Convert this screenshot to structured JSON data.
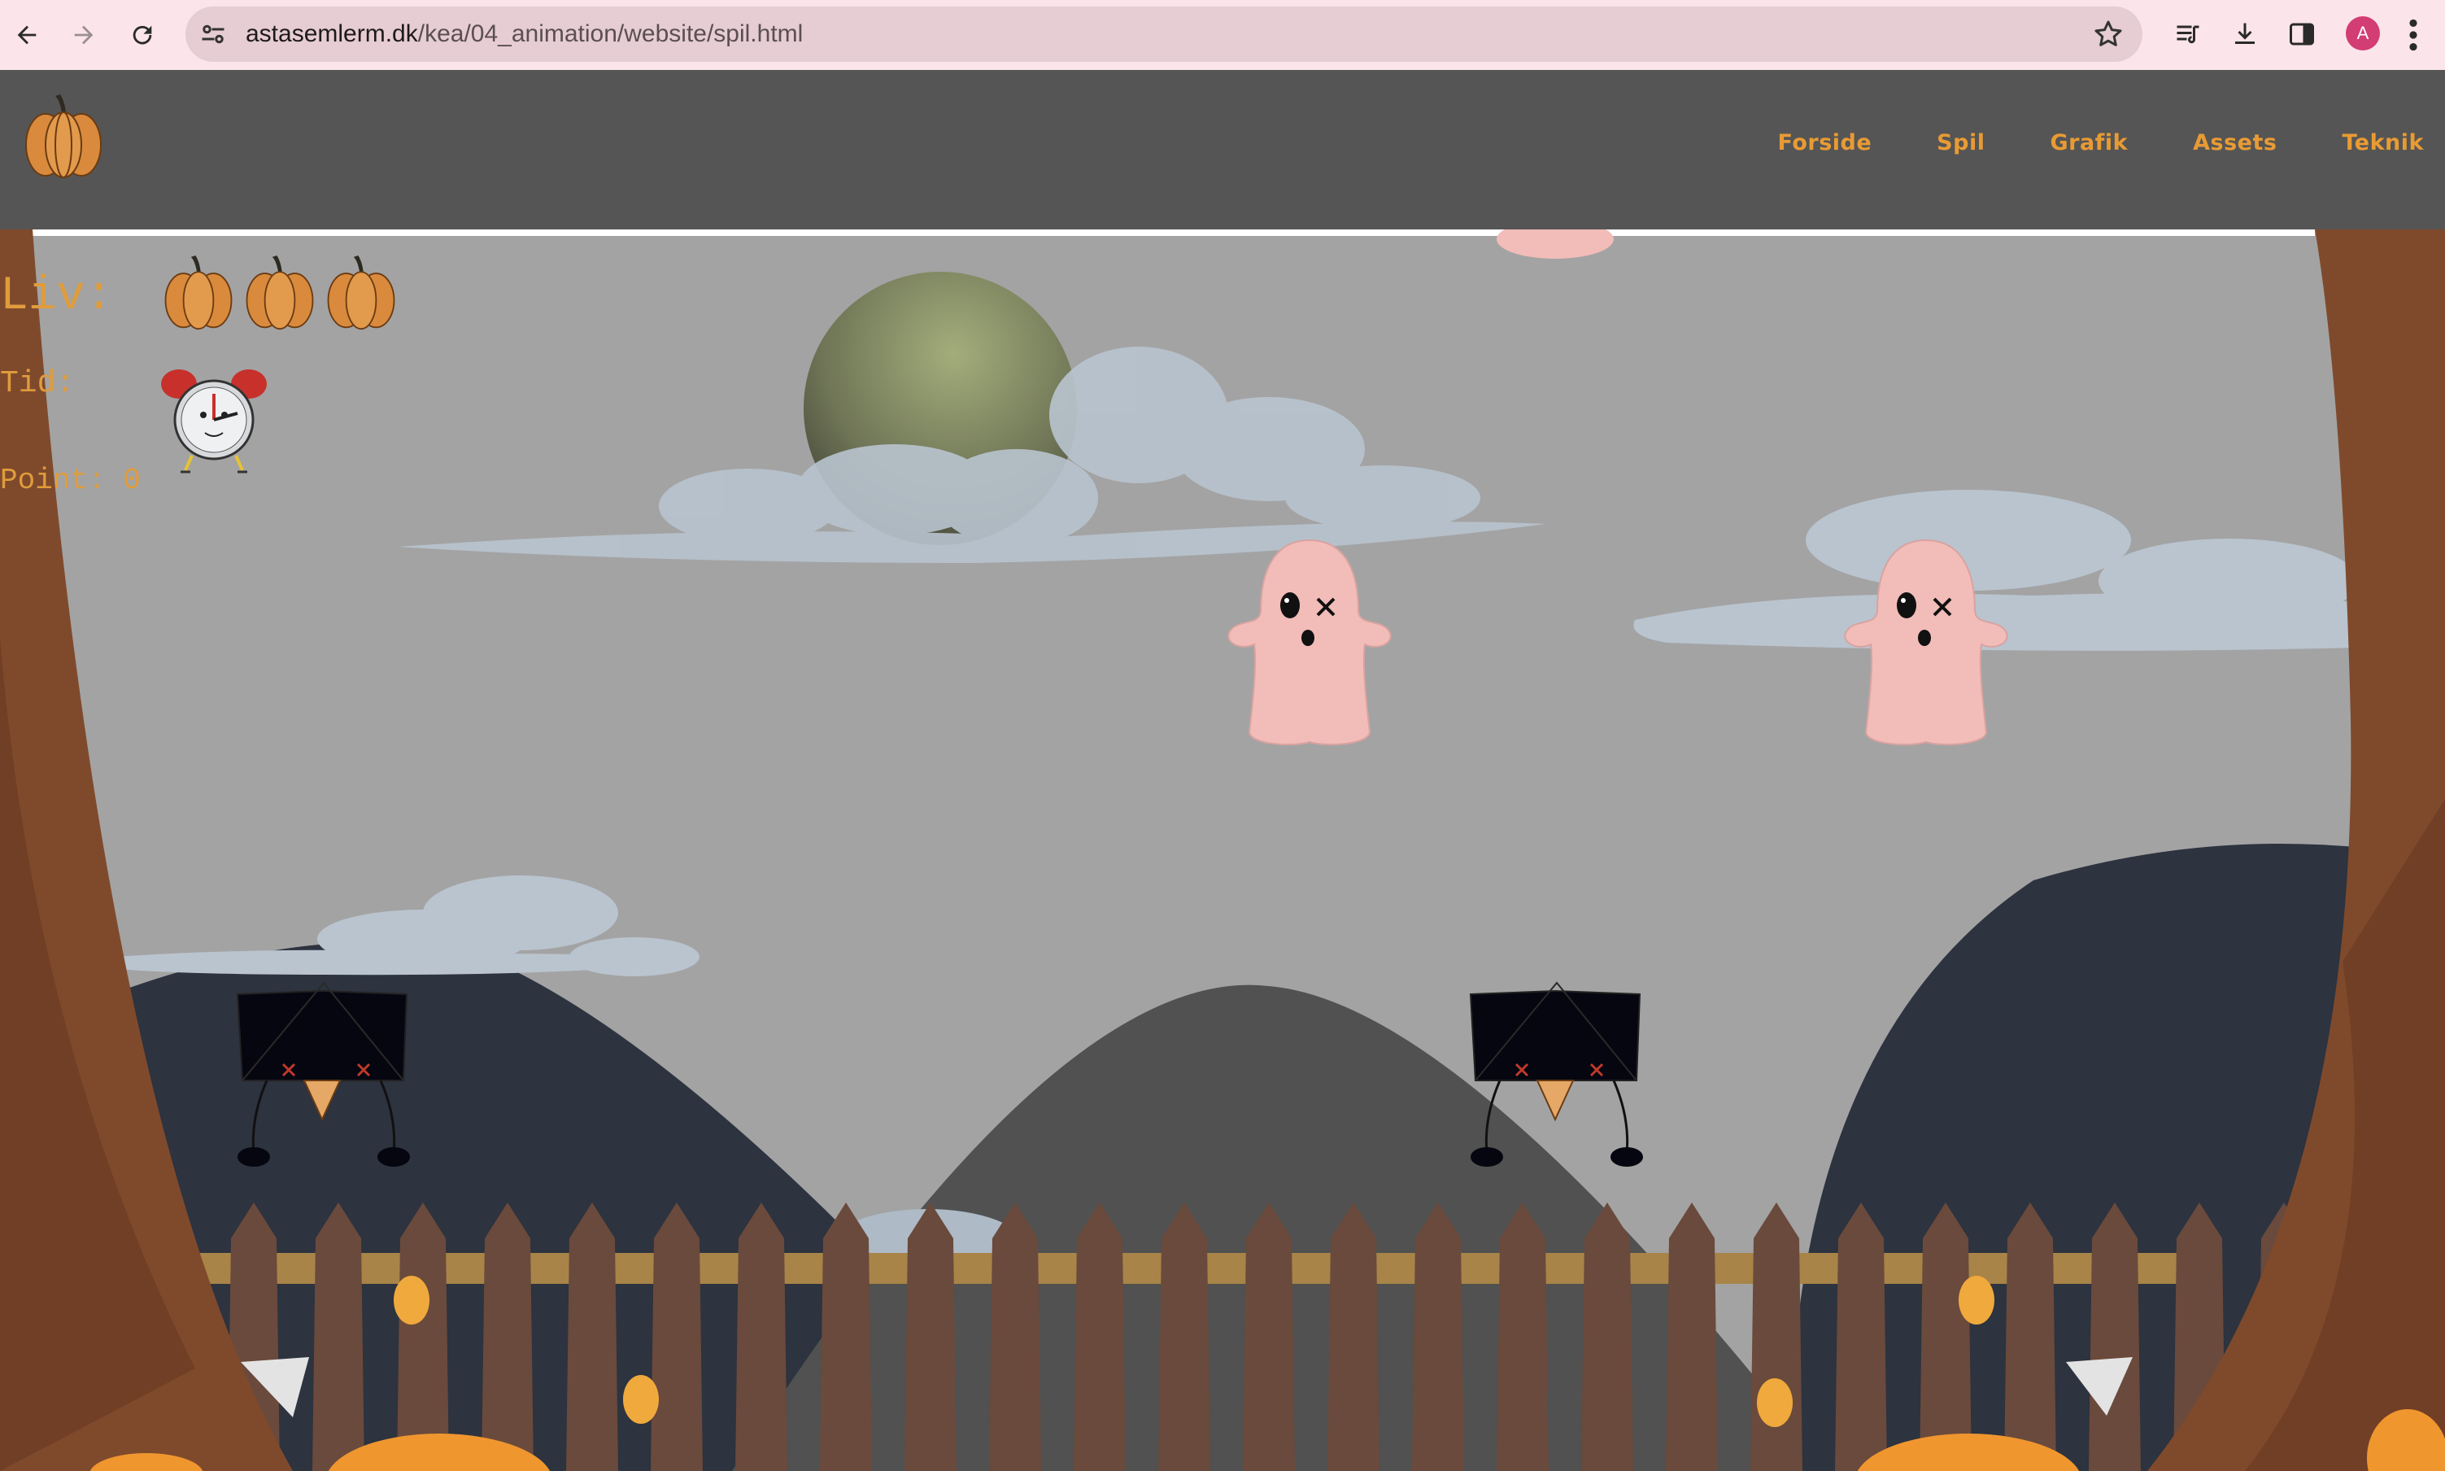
{
  "browser": {
    "url_host": "astasemlerm.dk",
    "url_path": "/kea/04_animation/website/spil.html",
    "avatar_letter": "A",
    "icons": [
      "back-arrow-icon",
      "forward-arrow-icon",
      "reload-icon",
      "site-settings-icon",
      "bookmark-star-icon",
      "media-queue-icon",
      "download-icon",
      "side-panel-icon",
      "menu-dots-icon"
    ]
  },
  "site": {
    "logo_icon": "pumpkin-logo-icon",
    "nav": [
      {
        "label": "Forside"
      },
      {
        "label": "Spil"
      },
      {
        "label": "Grafik"
      },
      {
        "label": "Assets"
      },
      {
        "label": "Teknik"
      }
    ],
    "nav_color": "#e89b34",
    "header_color": "#555555"
  },
  "game": {
    "hud": {
      "lives_label": "Liv:",
      "lives_count": 3,
      "time_label": "Tid:",
      "points_label": "Point: 0"
    },
    "hud_color": "#e09c3c",
    "sprites": [
      "pumpkin-life-icon",
      "alarm-clock-icon",
      "ghost-sprite",
      "crow-sprite",
      "moon",
      "cloud",
      "fence",
      "tree"
    ]
  }
}
